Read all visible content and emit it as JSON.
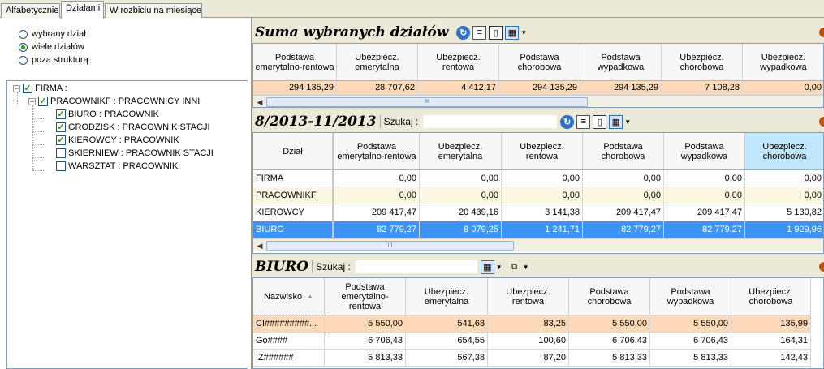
{
  "tabs": [
    "Alfabetycznie",
    "Działami",
    "W rozbiciu na miesiące"
  ],
  "left": {
    "radios": [
      {
        "label": "wybrany dział",
        "checked": false
      },
      {
        "label": "wiele działów",
        "checked": true
      },
      {
        "label": "poza strukturą",
        "checked": false
      }
    ],
    "tree": [
      {
        "label": "FIRMA :",
        "checked": true,
        "expander": "−"
      },
      {
        "label": "PRACOWNIKF : PRACOWNICY INNI",
        "checked": true,
        "expander": "−"
      },
      {
        "label": "BIURO : PRACOWNIK",
        "checked": true
      },
      {
        "label": "GRODZISK : PRACOWNIK STACJI",
        "checked": true
      },
      {
        "label": "KIEROWCY : PRACOWNIK",
        "checked": true
      },
      {
        "label": "SKIERNIEW : PRACOWNIK STACJI",
        "checked": false
      },
      {
        "label": "WARSZTAT : PRACOWNIK",
        "checked": false
      }
    ]
  },
  "suma": {
    "title": "Suma wybranych działów",
    "headers": [
      "Podstawa emerytalno-rentowa",
      "Ubezpiecz. emerytalna",
      "Ubezpiecz. rentowa",
      "Podstawa chorobowa",
      "Podstawa wypadkowa",
      "Ubezpiecz. chorobowa",
      "Ubezpiecz. wypadkowa"
    ],
    "values": [
      "294 135,29",
      "28 707,62",
      "4 412,17",
      "294 135,29",
      "294 135,29",
      "7 108,28",
      "0,00"
    ]
  },
  "period": {
    "title": "8/2013-11/2013",
    "search_label": "Szukaj :",
    "headers": [
      "Dział",
      "Podstawa emerytalno-rentowa",
      "Ubezpiecz. emerytalna",
      "Ubezpiecz. rentowa",
      "Podstawa chorobowa",
      "Podstawa wypadkowa",
      "Ubezpiecz. chorobowa"
    ],
    "rows": [
      [
        "FIRMA",
        "0,00",
        "0,00",
        "0,00",
        "0,00",
        "0,00",
        "0,00"
      ],
      [
        "PRACOWNIKF",
        "0,00",
        "0,00",
        "0,00",
        "0,00",
        "0,00",
        "0,00"
      ],
      [
        "KIEROWCY",
        "209 417,47",
        "20 439,16",
        "3 141,38",
        "209 417,47",
        "209 417,47",
        "5 130,82"
      ],
      [
        "BIURO",
        "82 779,27",
        "8 079,25",
        "1 241,71",
        "82 779,27",
        "82 779,27",
        "1 929,96"
      ]
    ]
  },
  "biuro": {
    "title": "BIURO",
    "search_label": "Szukaj :",
    "headers": [
      "Nazwisko",
      "Podstawa emerytalno-rentowa",
      "Ubezpiecz. emerytalna",
      "Ubezpiecz. rentowa",
      "Podstawa chorobowa",
      "Podstawa wypadkowa",
      "Ubezpiecz. chorobowa"
    ],
    "rows": [
      [
        "CI#########...",
        "5 550,00",
        "541,68",
        "83,25",
        "5 550,00",
        "5 550,00",
        "135,99"
      ],
      [
        "Go####",
        "6 706,43",
        "654,55",
        "100,60",
        "6 706,43",
        "6 706,43",
        "164,31"
      ],
      [
        "IZ######",
        "5 813,33",
        "567,38",
        "87,20",
        "5 813,33",
        "5 813,33",
        "142,43"
      ]
    ]
  },
  "colors": {
    "sum_row": "#fcd9b8",
    "cream_row": "#fdf9e2",
    "selected_row": "#3d94f6",
    "highlight_header": "#bfe6fa"
  },
  "scroll_thumb_glyph": "III"
}
